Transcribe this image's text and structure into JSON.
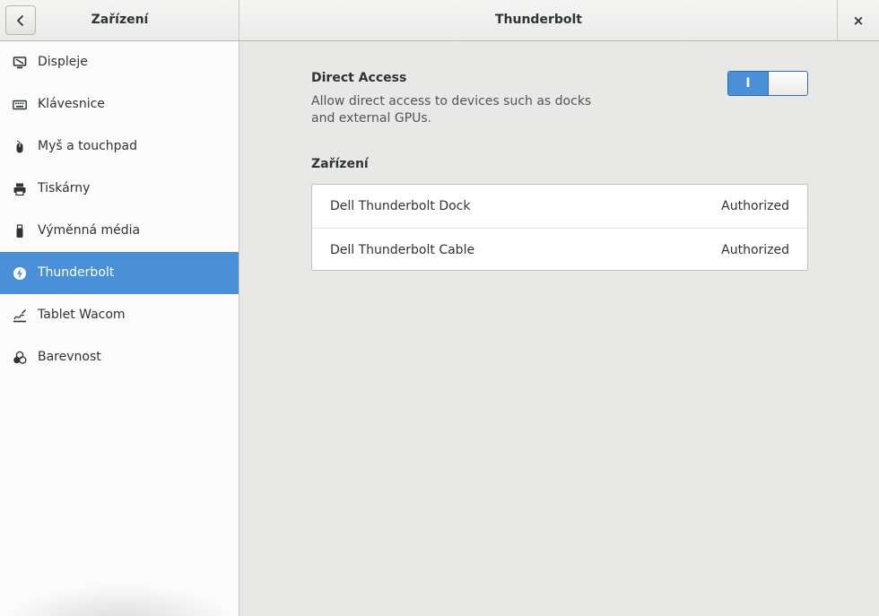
{
  "header": {
    "left_title": "Zařízení",
    "main_title": "Thunderbolt",
    "close_label": "×"
  },
  "sidebar": {
    "items": [
      {
        "label": "Displeje",
        "icon": "display-icon"
      },
      {
        "label": "Klávesnice",
        "icon": "keyboard-icon"
      },
      {
        "label": "Myš a touchpad",
        "icon": "mouse-icon"
      },
      {
        "label": "Tiskárny",
        "icon": "printer-icon"
      },
      {
        "label": "Výměnná média",
        "icon": "usb-drive-icon"
      },
      {
        "label": "Thunderbolt",
        "icon": "thunderbolt-icon",
        "selected": true
      },
      {
        "label": "Tablet Wacom",
        "icon": "tablet-pen-icon"
      },
      {
        "label": "Barevnost",
        "icon": "color-icon"
      }
    ]
  },
  "direct_access": {
    "title": "Direct Access",
    "description": "Allow direct access to devices such as docks and external GPUs.",
    "switch_on_label": "I",
    "enabled": true
  },
  "devices": {
    "heading": "Zařízení",
    "rows": [
      {
        "name": "Dell Thunderbolt Dock",
        "status": "Authorized"
      },
      {
        "name": "Dell Thunderbolt Cable",
        "status": "Authorized"
      }
    ]
  },
  "colors": {
    "accent": "#4a90d9",
    "sidebar_bg": "#fbfbfb",
    "main_bg": "#e8e8e7"
  }
}
